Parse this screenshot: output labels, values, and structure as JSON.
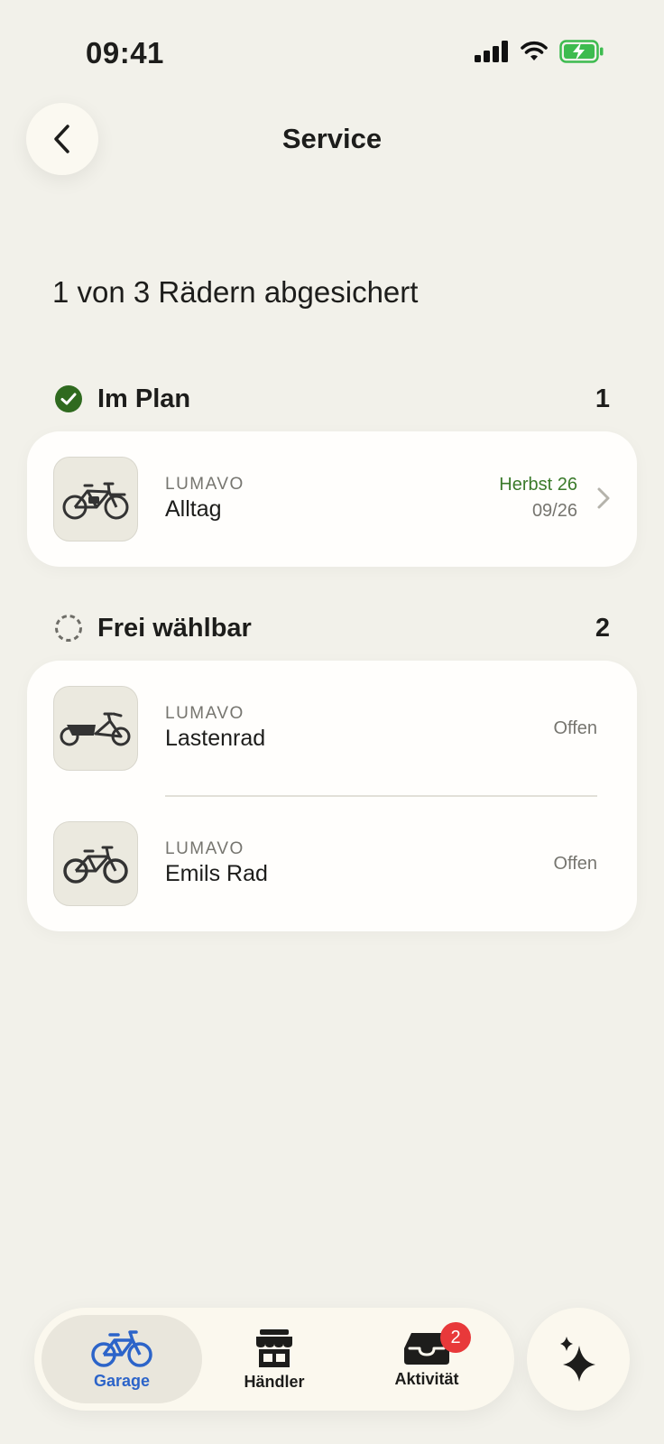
{
  "status_bar": {
    "time": "09:41"
  },
  "nav": {
    "title": "Service"
  },
  "summary": "1 von 3 Rädern abgesichert",
  "sections": [
    {
      "label": "Im Plan",
      "count": "1",
      "items": [
        {
          "brand": "LUMAVO",
          "name": "Alltag",
          "season": "Herbst 26",
          "date": "09/26"
        }
      ]
    },
    {
      "label": "Frei wählbar",
      "count": "2",
      "items": [
        {
          "brand": "LUMAVO",
          "name": "Lastenrad",
          "status": "Offen"
        },
        {
          "brand": "LUMAVO",
          "name": "Emils Rad",
          "status": "Offen"
        }
      ]
    }
  ],
  "tabbar": {
    "tabs": [
      {
        "label": "Garage",
        "icon": "bicycle-icon",
        "active": true
      },
      {
        "label": "Händler",
        "icon": "store-icon"
      },
      {
        "label": "Aktivität",
        "icon": "inbox-icon",
        "badge": "2"
      }
    ],
    "assistant_icon": "sparkle-icon"
  },
  "colors": {
    "background": "#f2f1ea",
    "accent": "#2c64c9",
    "success": "#2f6a1f",
    "badge": "#e8393a"
  }
}
